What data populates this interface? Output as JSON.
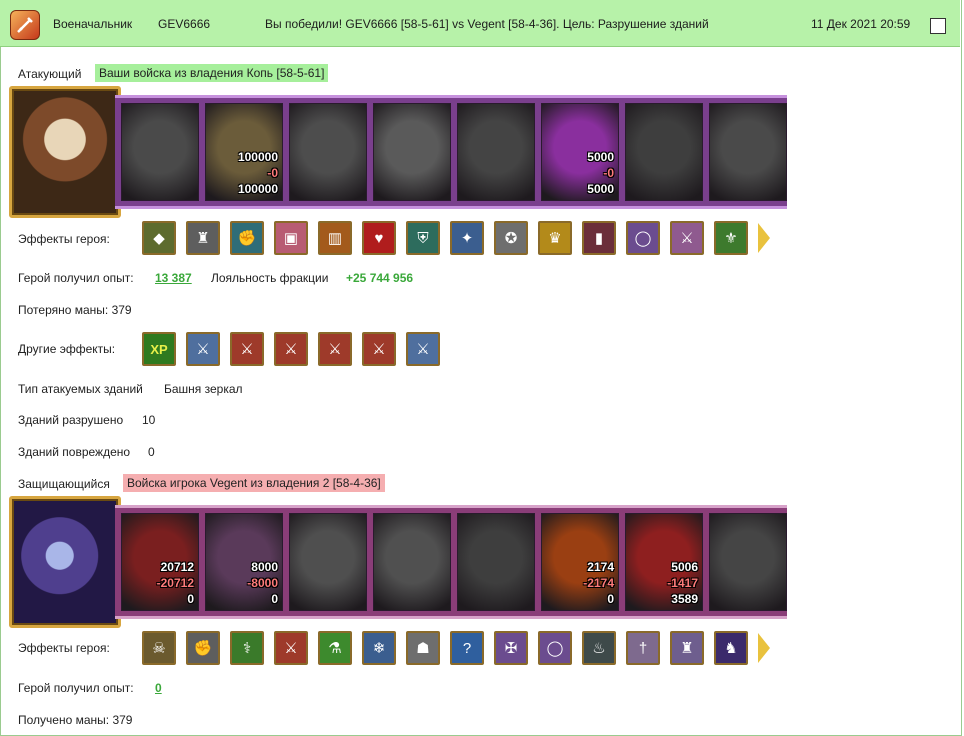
{
  "header": {
    "rank": "Военачальник",
    "player": "GEV6666",
    "message": "Вы победили! GEV6666 [58-5-61] vs Vegent [58-4-36]. Цель: Разрушение зданий",
    "datetime": "11 Дек 2021 20:59"
  },
  "attacker": {
    "label": "Атакующий",
    "troops": "Ваши войска из владения Копь [58-5-61]",
    "units": [
      {
        "color": "#4a4a4a",
        "n1": "",
        "n2": "",
        "n3": ""
      },
      {
        "color": "#6b5c3a",
        "n1": "100000",
        "n2": "-0",
        "n3": "100000"
      },
      {
        "color": "#4d4d4d",
        "n1": "",
        "n2": "",
        "n3": ""
      },
      {
        "color": "#5a5a5a",
        "n1": "",
        "n2": "",
        "n3": ""
      },
      {
        "color": "#444444",
        "n1": "",
        "n2": "",
        "n3": ""
      },
      {
        "color": "#8a2f9e",
        "n1": "5000",
        "n2": "-0",
        "n3": "5000"
      },
      {
        "color": "#3e3e3e",
        "n1": "",
        "n2": "",
        "n3": ""
      },
      {
        "color": "#4a4a4a",
        "n1": "",
        "n2": "",
        "n3": ""
      }
    ],
    "hero_effects_label": "Эффекты героя:",
    "hero_effects": [
      {
        "name": "gem-cluster-icon",
        "glyph": "◆",
        "bg": "#5d6b2e"
      },
      {
        "name": "knight-helmet-icon",
        "glyph": "♜",
        "bg": "#5e5e5e"
      },
      {
        "name": "blue-gauntlet-icon",
        "glyph": "✊",
        "bg": "#2f6d78"
      },
      {
        "name": "gift-box-icon",
        "glyph": "▣",
        "bg": "#b85c73"
      },
      {
        "name": "treasure-chest-icon",
        "glyph": "▥",
        "bg": "#a35a1c"
      },
      {
        "name": "heart-icon",
        "glyph": "♥",
        "bg": "#b01d1d"
      },
      {
        "name": "shield-icon",
        "glyph": "⛨",
        "bg": "#2d6c5d"
      },
      {
        "name": "crystal-icon",
        "glyph": "✦",
        "bg": "#3b5e8f"
      },
      {
        "name": "pentagram-icon",
        "glyph": "✪",
        "bg": "#6e6e6e"
      },
      {
        "name": "golden-armor-icon",
        "glyph": "♛",
        "bg": "#b38a1a"
      },
      {
        "name": "boots-icon",
        "glyph": "▮",
        "bg": "#6b2e3a"
      },
      {
        "name": "ring-icon",
        "glyph": "◯",
        "bg": "#6b4c8f"
      },
      {
        "name": "sword-icon",
        "glyph": "⚔",
        "bg": "#8f5a8f"
      },
      {
        "name": "fleur-de-lis-icon",
        "glyph": "⚜",
        "bg": "#3d7a2d"
      }
    ],
    "exp_label": "Герой получил опыт:",
    "exp_value": "13 387",
    "loyalty_label": "Лояльность фракции",
    "loyalty_value": "+25 744 956",
    "mana_text": "Потеряно маны: 379",
    "other_effects_label": "Другие эффекты:",
    "other_effects": [
      {
        "name": "xp-bonus-icon",
        "glyph": "XP",
        "bg": "#2f7a1f"
      },
      {
        "name": "blue-sword-icon",
        "glyph": "⚔",
        "bg": "#4f6f9e"
      },
      {
        "name": "fist-sword-icon",
        "glyph": "⚔",
        "bg": "#9e3a2a"
      },
      {
        "name": "fist-sword-icon",
        "glyph": "⚔",
        "bg": "#9e3a2a"
      },
      {
        "name": "fist-sword-icon",
        "glyph": "⚔",
        "bg": "#9e3a2a"
      },
      {
        "name": "fist-sword-icon",
        "glyph": "⚔",
        "bg": "#9e3a2a"
      },
      {
        "name": "blue-sword-icon",
        "glyph": "⚔",
        "bg": "#4f6f9e"
      }
    ],
    "building_type_label": "Тип атакуемых зданий",
    "building_type_value": "Башня зеркал",
    "destroyed_label": "Зданий разрушено",
    "destroyed_value": "10",
    "damaged_label": "Зданий повреждено",
    "damaged_value": "0"
  },
  "defender": {
    "label": "Защищающийся",
    "troops": "Войска игрока Vegent из владения 2 [58-4-36]",
    "units": [
      {
        "color": "#7a1f1f",
        "n1": "20712",
        "n2": "-20712",
        "n3": "0"
      },
      {
        "color": "#5a3a5a",
        "n1": "8000",
        "n2": "-8000",
        "n3": "0"
      },
      {
        "color": "#4f4f4f",
        "n1": "",
        "n2": "",
        "n3": ""
      },
      {
        "color": "#505050",
        "n1": "",
        "n2": "",
        "n3": ""
      },
      {
        "color": "#3e3e3e",
        "n1": "",
        "n2": "",
        "n3": ""
      },
      {
        "color": "#9a3f12",
        "n1": "2174",
        "n2": "-2174",
        "n3": "0"
      },
      {
        "color": "#8e1f1f",
        "n1": "5006",
        "n2": "-1417",
        "n3": "3589"
      },
      {
        "color": "#454545",
        "n1": "",
        "n2": "",
        "n3": ""
      }
    ],
    "hero_effects_label": "Эффекты героя:",
    "hero_effects": [
      {
        "name": "skull-totem-icon",
        "glyph": "☠",
        "bg": "#6b5a2e"
      },
      {
        "name": "blue-gauntlet-icon",
        "glyph": "✊",
        "bg": "#5e5e5e"
      },
      {
        "name": "green-staff-icon",
        "glyph": "⚕",
        "bg": "#3a7a2a"
      },
      {
        "name": "fist-sword-icon",
        "glyph": "⚔",
        "bg": "#9e3a2a"
      },
      {
        "name": "potion-icon",
        "glyph": "⚗",
        "bg": "#3d8a2d"
      },
      {
        "name": "ice-crystal-icon",
        "glyph": "❄",
        "bg": "#3b5e8f"
      },
      {
        "name": "skull-amulet-icon",
        "glyph": "☗",
        "bg": "#6e6e6e"
      },
      {
        "name": "question-mark-icon",
        "glyph": "?",
        "bg": "#2f5f9e"
      },
      {
        "name": "crossed-bones-icon",
        "glyph": "✠",
        "bg": "#6b4c8f"
      },
      {
        "name": "ring-icon",
        "glyph": "◯",
        "bg": "#6b4c8f"
      },
      {
        "name": "cauldron-icon",
        "glyph": "♨",
        "bg": "#3e4a4a"
      },
      {
        "name": "dagger-icon",
        "glyph": "†",
        "bg": "#7e6a8e"
      },
      {
        "name": "bone-armor-icon",
        "glyph": "♜",
        "bg": "#6e5e8e"
      },
      {
        "name": "dark-cloak-icon",
        "glyph": "♞",
        "bg": "#3b2a6b"
      }
    ],
    "exp_label": "Герой получил опыт:",
    "exp_value": "0",
    "mana_text": "Получено маны: 379"
  }
}
